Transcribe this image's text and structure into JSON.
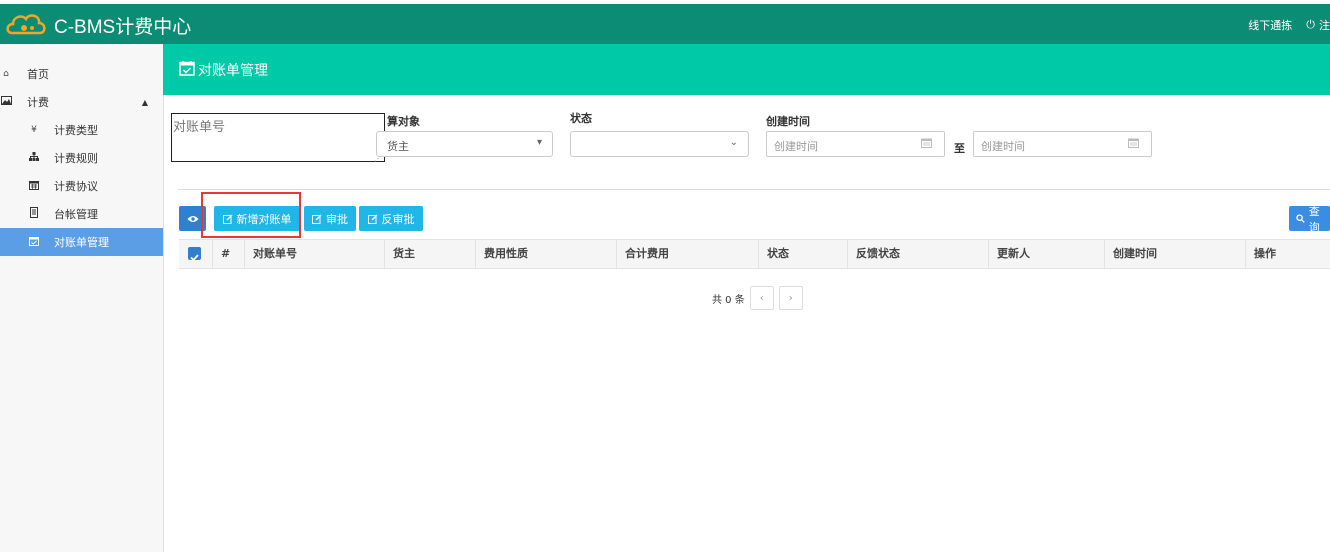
{
  "app": {
    "title": "C-BMS计费中心"
  },
  "topbar": {
    "offline_label": "线下通拣",
    "logout_label": "注"
  },
  "sidebar": {
    "items": [
      {
        "label": "首页",
        "icon": "home-icon"
      },
      {
        "label": "计费",
        "icon": "image-icon"
      },
      {
        "label": "计费类型",
        "icon": "yen-icon",
        "glyph": "¥"
      },
      {
        "label": "计费规则",
        "icon": "sitemap-icon"
      },
      {
        "label": "计费协议",
        "icon": "calendar-icon"
      },
      {
        "label": "台帐管理",
        "icon": "ledger-icon"
      },
      {
        "label": "对账单管理",
        "icon": "calendar-check-icon"
      }
    ]
  },
  "header": {
    "title": "对账单管理"
  },
  "filters": {
    "statement_no_placeholder": "对账单号",
    "target_label": "算对象",
    "target_value": "货主",
    "status_label": "状态",
    "status_value": "",
    "created_label": "创建时间",
    "created_from_placeholder": "创建时间",
    "to_label": "至",
    "created_to_placeholder": "创建时间"
  },
  "toolbar": {
    "add_label": "新增对账单",
    "approve_label": "审批",
    "unapprove_label": "反审批",
    "query_label": "查询"
  },
  "table": {
    "columns": [
      "#",
      "对账单号",
      "货主",
      "费用性质",
      "合计费用",
      "状态",
      "反馈状态",
      "更新人",
      "创建时间",
      "操作"
    ]
  },
  "pagination": {
    "total_text": "共 0 条",
    "prev": "‹",
    "next": "›"
  },
  "colors": {
    "topbar": "#0c8c74",
    "header": "#00c9a7",
    "active_nav": "#5b9ee5",
    "info_button": "#22b6e8",
    "primary_button": "#2f80d0",
    "highlight": "#e53935"
  }
}
